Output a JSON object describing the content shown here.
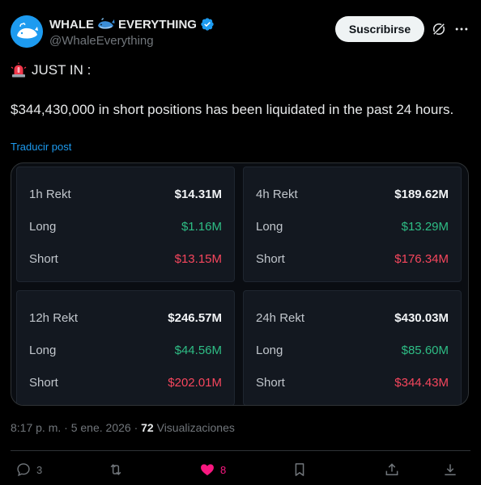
{
  "author": {
    "display_name": "WHALE",
    "display_name_suffix": "EVERYTHING",
    "handle": "@WhaleEverything",
    "verified": true
  },
  "header": {
    "subscribe_label": "Suscribirse"
  },
  "post": {
    "headline": "JUST IN :",
    "headline_emoji": "🚨",
    "body": "$344,430,000 in short positions has been liquidated in the past 24 hours.",
    "translate_label": "Traducir post"
  },
  "media": {
    "panels": [
      {
        "title": "1h Rekt",
        "total": "$14.31M",
        "long_label": "Long",
        "long": "$1.16M",
        "short_label": "Short",
        "short": "$13.15M"
      },
      {
        "title": "4h Rekt",
        "total": "$189.62M",
        "long_label": "Long",
        "long": "$13.29M",
        "short_label": "Short",
        "short": "$176.34M"
      },
      {
        "title": "12h Rekt",
        "total": "$246.57M",
        "long_label": "Long",
        "long": "$44.56M",
        "short_label": "Short",
        "short": "$202.01M"
      },
      {
        "title": "24h Rekt",
        "total": "$430.03M",
        "long_label": "Long",
        "long": "$85.60M",
        "short_label": "Short",
        "short": "$344.43M"
      }
    ]
  },
  "meta": {
    "time": "8:17 p. m.",
    "sep1": "·",
    "date": "5 ene. 2026",
    "sep2": "·",
    "views_count": "72",
    "views_label": "Visualizaciones"
  },
  "actions": {
    "replies": "3",
    "reposts": "",
    "likes": "8",
    "bookmarks": "",
    "share": "",
    "download": ""
  },
  "colors": {
    "accent": "#1d9bf0",
    "like": "#f91880",
    "long": "#2ebd85",
    "short": "#f6465d"
  }
}
